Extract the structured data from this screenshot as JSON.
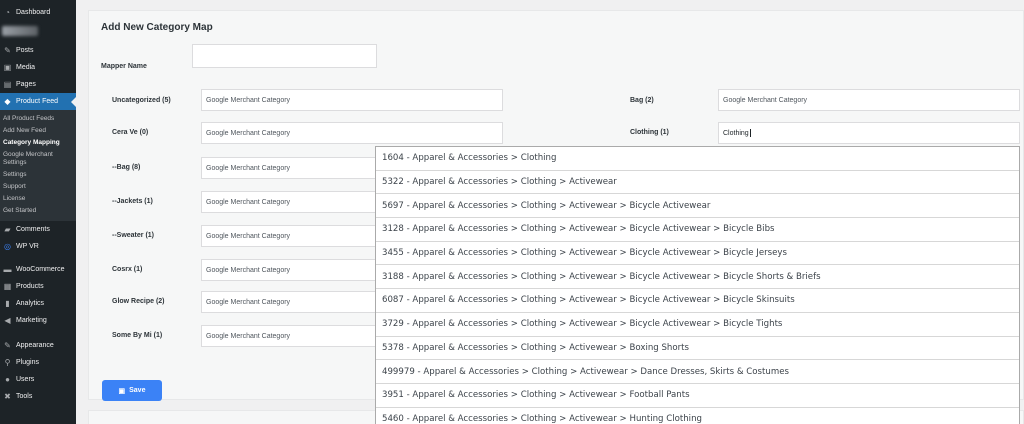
{
  "sidebar": {
    "dashboard": "Dashboard",
    "posts": "Posts",
    "media": "Media",
    "pages": "Pages",
    "product_feed": "Product Feed",
    "submenu": [
      "All Product Feeds",
      "Add New Feed",
      "Category Mapping",
      "Google Merchant Settings",
      "Settings",
      "Support",
      "License",
      "Get Started"
    ],
    "comments": "Comments",
    "wpvr": "WP VR",
    "woocommerce": "WooCommerce",
    "products": "Products",
    "analytics": "Analytics",
    "marketing": "Marketing",
    "appearance": "Appearance",
    "plugins": "Plugins",
    "users": "Users",
    "tools": "Tools"
  },
  "form": {
    "title": "Add New Category Map",
    "mapper_name_label": "Mapper Name",
    "mapper_name_value": "",
    "left_rows": [
      {
        "label": "Uncategorized (5)",
        "placeholder": "Google Merchant Category"
      },
      {
        "label": "Cera Ve (0)",
        "placeholder": "Google Merchant Category"
      },
      {
        "label": "--Bag (8)",
        "placeholder": "Google Merchant Category"
      },
      {
        "label": "--Jackets (1)",
        "placeholder": "Google Merchant Category"
      },
      {
        "label": "--Sweater (1)",
        "placeholder": "Google Merchant Category"
      },
      {
        "label": "Cosrx (1)",
        "placeholder": "Google Merchant Category"
      },
      {
        "label": "Glow Recipe (2)",
        "placeholder": "Google Merchant Category"
      },
      {
        "label": "Some By Mi (1)",
        "placeholder": "Google Merchant Category"
      }
    ],
    "right_rows": [
      {
        "label": "Bag (2)",
        "placeholder": "Google Merchant Category",
        "value": ""
      },
      {
        "label": "Clothing (1)",
        "placeholder": "Google Merchant Category",
        "value": "Clothing"
      }
    ],
    "save_label": "Save"
  },
  "dropdown": {
    "options": [
      "1604 - Apparel & Accessories > Clothing",
      "5322 - Apparel & Accessories > Clothing > Activewear",
      "5697 - Apparel & Accessories > Clothing > Activewear > Bicycle Activewear",
      "3128 - Apparel & Accessories > Clothing > Activewear > Bicycle Activewear > Bicycle Bibs",
      "3455 - Apparel & Accessories > Clothing > Activewear > Bicycle Activewear > Bicycle Jerseys",
      "3188 - Apparel & Accessories > Clothing > Activewear > Bicycle Activewear > Bicycle Shorts & Briefs",
      "6087 - Apparel & Accessories > Clothing > Activewear > Bicycle Activewear > Bicycle Skinsuits",
      "3729 - Apparel & Accessories > Clothing > Activewear > Bicycle Activewear > Bicycle Tights",
      "5378 - Apparel & Accessories > Clothing > Activewear > Boxing Shorts",
      "499979 - Apparel & Accessories > Clothing > Activewear > Dance Dresses, Skirts & Costumes",
      "3951 - Apparel & Accessories > Clothing > Activewear > Football Pants",
      "5460 - Apparel & Accessories > Clothing > Activewear > Hunting Clothing"
    ]
  },
  "colors": {
    "sidebar_bg": "#1d2327",
    "active_menu": "#2271b1",
    "save_button": "#3b82f6"
  }
}
